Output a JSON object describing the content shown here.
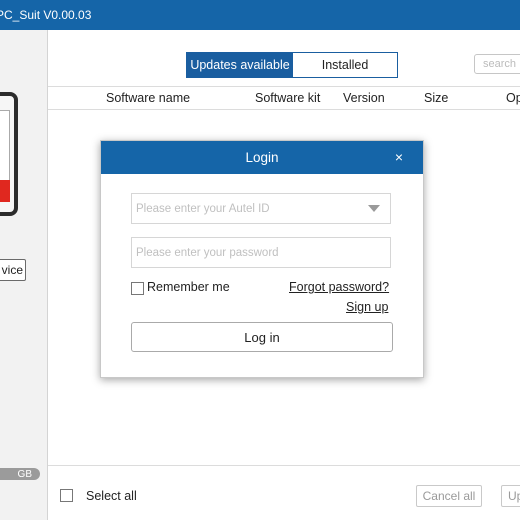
{
  "window": {
    "title": "PC_Suit V0.00.03"
  },
  "sidebar": {
    "device_button_label": "vice",
    "storage_label": "GB"
  },
  "tabs": [
    {
      "label": "Updates available",
      "active": true
    },
    {
      "label": "Installed",
      "active": false
    }
  ],
  "search": {
    "placeholder": "search"
  },
  "table": {
    "columns": [
      "Software name",
      "Software kit",
      "Version",
      "Size",
      "Op"
    ]
  },
  "footer": {
    "select_all_label": "Select all",
    "cancel_all_label": "Cancel all",
    "update_label": "Up"
  },
  "login": {
    "title": "Login",
    "close_icon": "×",
    "id_placeholder": "Please enter your Autel ID",
    "password_placeholder": "Please enter your password",
    "remember_label": "Remember me",
    "forgot_label": "Forgot password?",
    "signup_label": "Sign up",
    "login_button": "Log in"
  },
  "colors": {
    "brand_blue": "#1565a8",
    "accent_red": "#e0281f"
  }
}
